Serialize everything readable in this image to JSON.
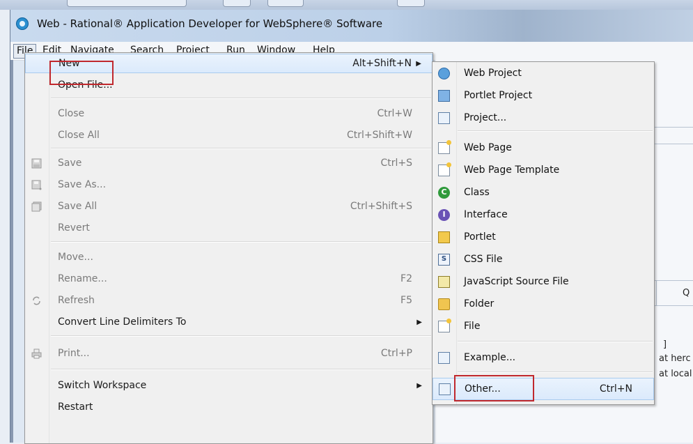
{
  "window": {
    "title": "Web - Rational® Application Developer for WebSphere® Software"
  },
  "menubar": [
    "File",
    "Edit",
    "Navigate",
    "Search",
    "Project",
    "Run",
    "Window",
    "Help"
  ],
  "file_menu": {
    "items": [
      {
        "label": "New",
        "shortcut": "Alt+Shift+N",
        "submenu": true,
        "highlighted": true,
        "enabled": true
      },
      {
        "label": "Open File...",
        "enabled": true
      },
      {
        "label": "Close",
        "shortcut": "Ctrl+W",
        "enabled": false
      },
      {
        "label": "Close All",
        "shortcut": "Ctrl+Shift+W",
        "enabled": false
      },
      {
        "label": "Save",
        "shortcut": "Ctrl+S",
        "enabled": false,
        "icon": "save-icon"
      },
      {
        "label": "Save As...",
        "enabled": false,
        "icon": "save-as-icon"
      },
      {
        "label": "Save All",
        "shortcut": "Ctrl+Shift+S",
        "enabled": false,
        "icon": "save-all-icon"
      },
      {
        "label": "Revert",
        "enabled": false
      },
      {
        "label": "Move...",
        "enabled": false
      },
      {
        "label": "Rename...",
        "shortcut": "F2",
        "enabled": false
      },
      {
        "label": "Refresh",
        "shortcut": "F5",
        "enabled": false,
        "icon": "refresh-icon"
      },
      {
        "label": "Convert Line Delimiters To",
        "submenu": true,
        "enabled": true
      },
      {
        "label": "Print...",
        "shortcut": "Ctrl+P",
        "enabled": false,
        "icon": "print-icon"
      },
      {
        "label": "Switch Workspace",
        "submenu": true,
        "enabled": true
      },
      {
        "label": "Restart",
        "enabled": true
      }
    ]
  },
  "new_submenu": {
    "items": [
      {
        "label": "Web Project",
        "icon": "web-project-icon"
      },
      {
        "label": "Portlet Project",
        "icon": "portlet-project-icon"
      },
      {
        "label": "Project...",
        "icon": "project-icon"
      },
      {
        "label": "Web Page",
        "icon": "web-page-icon"
      },
      {
        "label": "Web Page Template",
        "icon": "web-page-template-icon"
      },
      {
        "label": "Class",
        "icon": "class-icon"
      },
      {
        "label": "Interface",
        "icon": "interface-icon"
      },
      {
        "label": "Portlet",
        "icon": "portlet-icon"
      },
      {
        "label": "CSS File",
        "icon": "css-file-icon"
      },
      {
        "label": "JavaScript Source File",
        "icon": "javascript-file-icon"
      },
      {
        "label": "Folder",
        "icon": "folder-icon"
      },
      {
        "label": "File",
        "icon": "file-icon"
      },
      {
        "label": "Example...",
        "icon": "example-icon"
      },
      {
        "label": "Other...",
        "shortcut": "Ctrl+N",
        "icon": "other-icon",
        "highlighted": true
      }
    ]
  },
  "background": {
    "tab_fragment": "Q",
    "line1": "at herc",
    "line2": "at local",
    "fragment": "]"
  },
  "colors": {
    "highlight_box": "#c0282d",
    "menu_bg": "#f0f0f0",
    "hover_bg": "#dbeafc"
  }
}
